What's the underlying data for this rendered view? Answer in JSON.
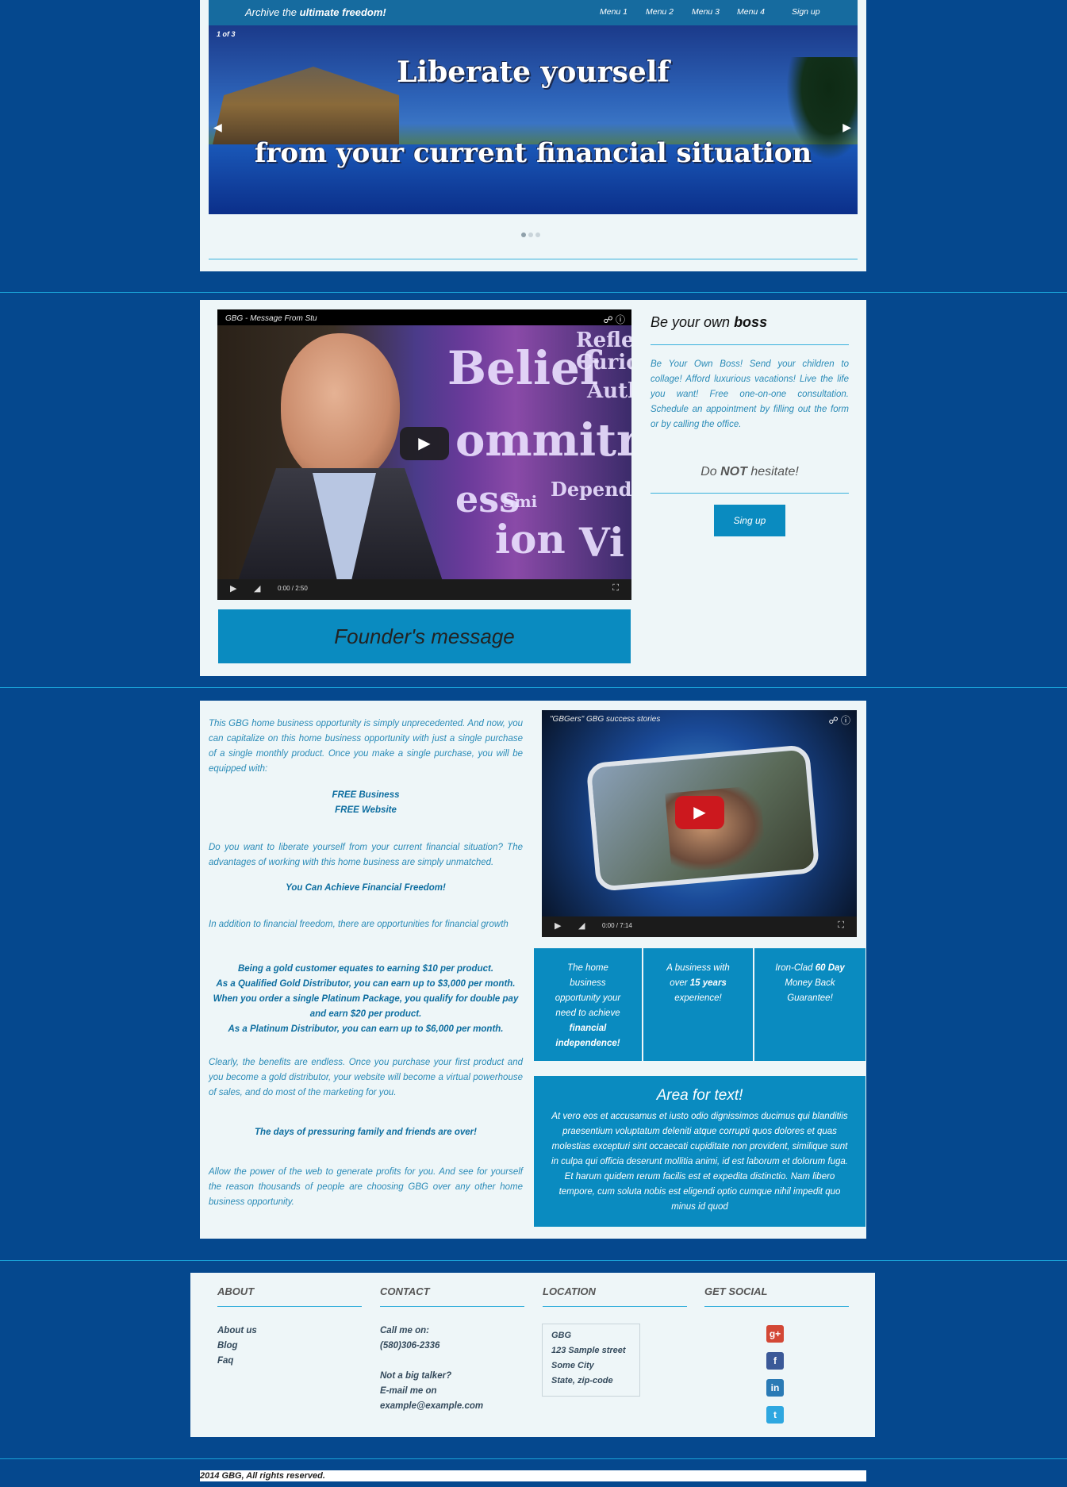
{
  "header": {
    "brand_prefix": "Archive the ",
    "brand_bold": "ultimate freedom!",
    "menu": [
      "Menu 1",
      "Menu 2",
      "Menu 3",
      "Menu 4",
      "Sign up"
    ]
  },
  "slider": {
    "counter": "1  of  3",
    "headline_1": "Liberate yourself",
    "headline_2": "from your current financial situation",
    "prev_arrow": "◀",
    "next_arrow": "▶",
    "dot_count": 3,
    "active_slide": 1
  },
  "video1": {
    "title": "GBG - Message From Stu",
    "time": "0:00 / 2:50",
    "words": [
      "Belief",
      "Reflec",
      "Curiosi",
      "Auth",
      "ommitr",
      "Dependa",
      "ess",
      "Smi",
      "ion",
      "Vi"
    ]
  },
  "founder_label": "Founder's message",
  "boss": {
    "title_prefix": "Be your own ",
    "title_bold": "boss",
    "text": "Be Your Own Boss! Send your children to collage! Afford luxurious vacations! Live the life you want! Free one-on-one consultation. Schedule an appointment by filling out the form or by calling the office.",
    "hesitate_prefix": "Do ",
    "hesitate_bold": "NOT",
    "hesitate_suffix": " hesitate!",
    "button": "Sing up"
  },
  "main": {
    "intro": "This GBG home business opportunity is simply unprecedented. And now, you can capitalize on this home business opportunity with just a single purchase of a single monthly product. Once you make a single purchase, you will be equipped with:",
    "free_business": "FREE Business",
    "free_website": "FREE Website",
    "question": "Do you want to liberate yourself from your current financial situation? The advantages of working with this home business are simply unmatched.",
    "freedom": "You Can Achieve Financial Freedom!",
    "growth": "In addition to financial freedom, there are opportunities for financial growth",
    "earnings_1": "Being a gold customer equates to earning $10 per product.",
    "earnings_2": "As a Qualified Gold Distributor, you can earn up to $3,000 per month.",
    "earnings_3": "When you order a single Platinum Package, you qualify for double pay and earn $20 per product.",
    "earnings_4": "As a Platinum Distributor, you can earn up to $6,000 per month.",
    "benefits": "Clearly, the benefits are endless. Once you purchase your first product and you become a gold distributor, your website will become a virtual powerhouse of sales, and do most of the marketing for you.",
    "days_over": "The days of pressuring family and friends are over!",
    "closing": "Allow the power of the web to generate profits for you. And see for yourself the reason thousands of people are choosing GBG over any other home business opportunity."
  },
  "video2": {
    "title": "\"GBGers\" GBG success stories",
    "time": "0:00 / 7:14"
  },
  "features": {
    "f1_text": "The home business opportunity your need to achieve ",
    "f1_bold": "financial independence!",
    "f2_prefix": "A business with over ",
    "f2_bold": "15 years",
    "f2_suffix": " experience!",
    "f3_prefix": "Iron-Clad ",
    "f3_bold": "60 Day",
    "f3_suffix": " Money Back Guarantee!"
  },
  "area": {
    "title": "Area for text!",
    "text": "At vero eos et accusamus et iusto odio dignissimos ducimus qui blanditiis praesentium voluptatum deleniti atque corrupti quos dolores et quas molestias excepturi sint occaecati cupiditate non provident, similique sunt in culpa qui officia deserunt mollitia animi, id est laborum et dolorum fuga. Et harum quidem rerum facilis est et expedita distinctio. Nam libero tempore, cum soluta nobis est eligendi optio cumque nihil impedit quo minus id quod"
  },
  "footer": {
    "about_head": "ABOUT",
    "about_links": [
      "About us",
      "Blog",
      "Faq"
    ],
    "contact_head": "CONTACT",
    "call_label": "Call me on:",
    "phone": "(580)306-2336",
    "talker": "Not a big talker?",
    "email_label": "E-mail me on",
    "email": "example@example.com",
    "location_head": "LOCATION",
    "address": [
      "GBG",
      "123 Sample street",
      "Some City",
      "State, zip-code"
    ],
    "social_head": "GET SOCIAL",
    "social_glyphs": [
      "g+",
      "f",
      "in",
      "t"
    ]
  },
  "copyright": "2014 GBG, All rights reserved.",
  "colors": {
    "page_bg": "#05488e",
    "panel_bg": "#eef6f8",
    "accent": "#0a8bc0",
    "text_blue": "#2a8bb7",
    "rule": "#38b0dc"
  }
}
